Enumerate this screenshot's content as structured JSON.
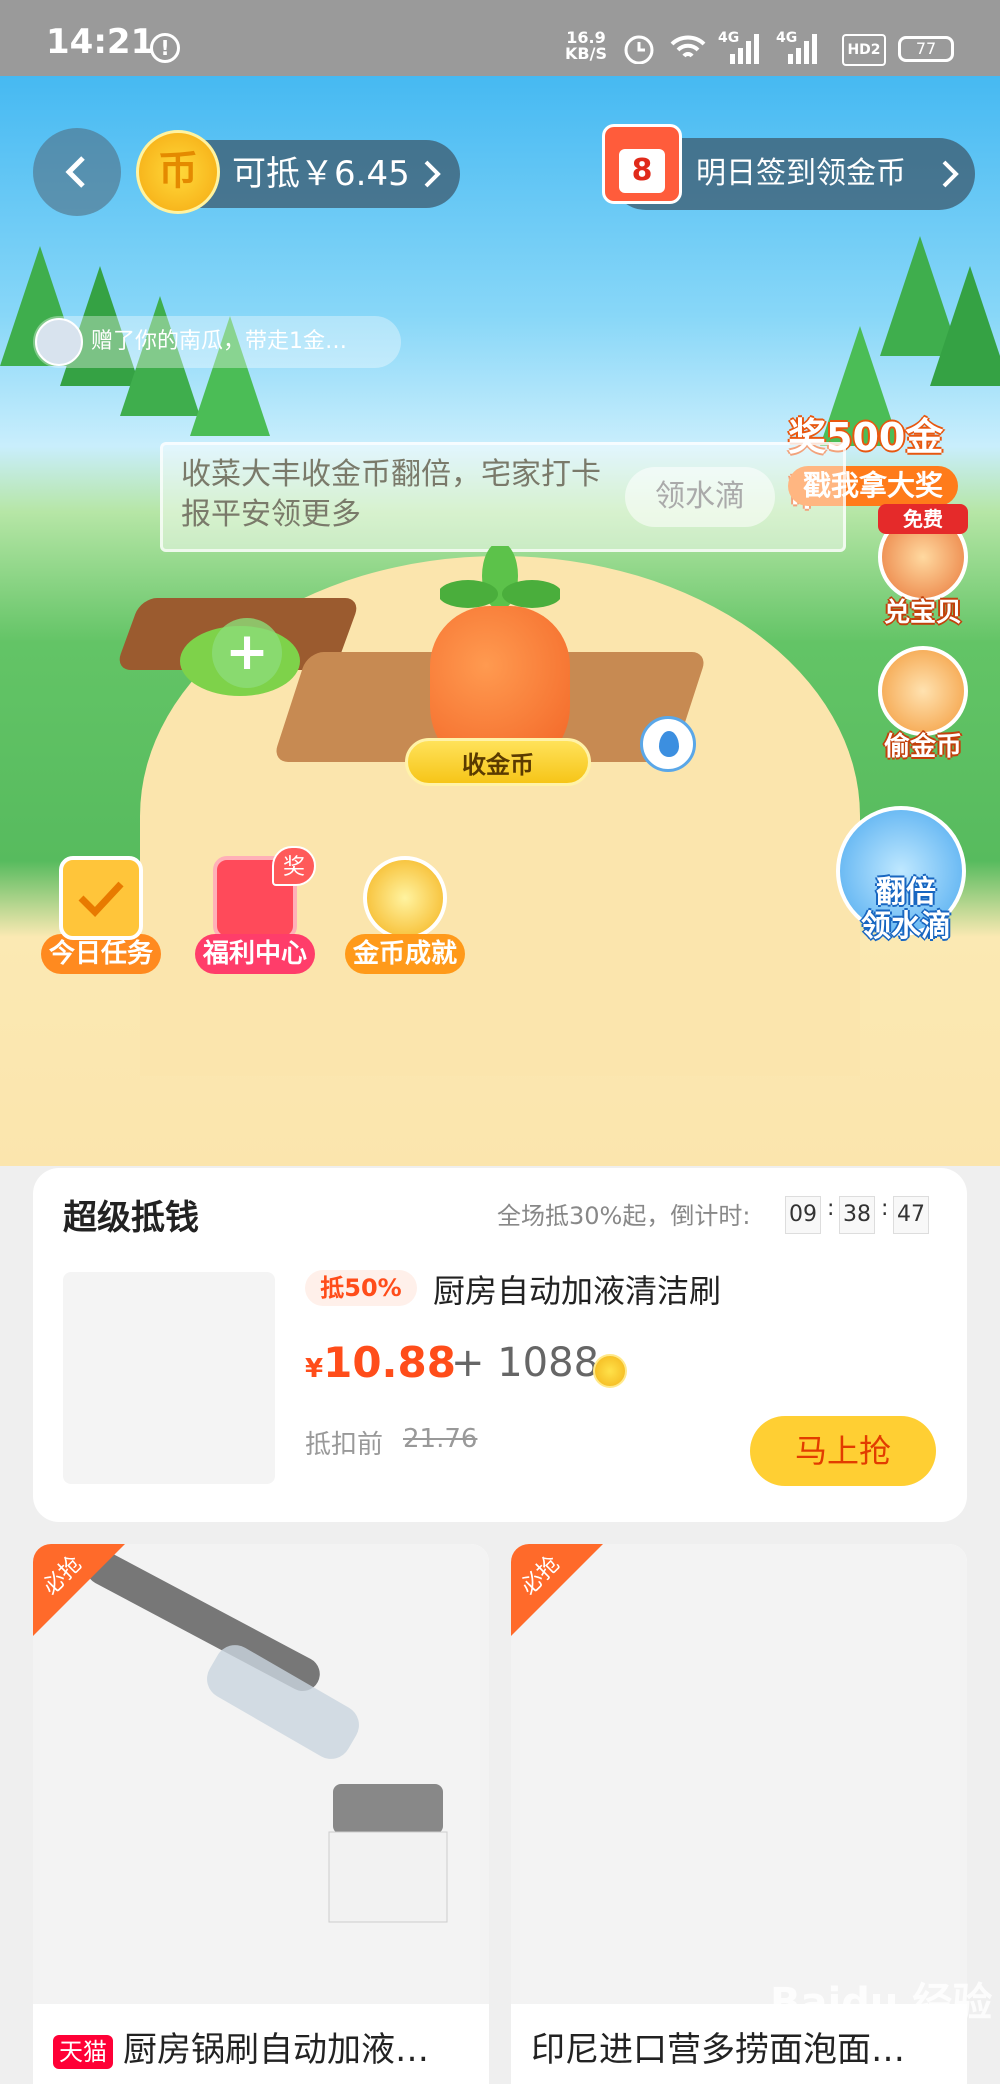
{
  "status_bar": {
    "time": "14:21",
    "net_speed_value": "16.9",
    "net_speed_unit": "KB/S",
    "signal_1": "4G",
    "signal_2": "4G",
    "hd": "HD2",
    "battery": "77"
  },
  "header": {
    "coin_symbol": "币",
    "coin_balance_text": "可抵￥6.45",
    "calendar_day": "8",
    "sign_in_text": "明日签到领金币"
  },
  "feed_message": "赠了你的南瓜，带走1金…",
  "promo": {
    "title": "奖500金币",
    "action": "戳我拿大奖"
  },
  "tip": {
    "text": "收菜大丰收金币翻倍，宅家打卡报平安领更多",
    "button": "领水滴"
  },
  "farm": {
    "collect_button": "收金币"
  },
  "side_actions": [
    {
      "label": "兑宝贝",
      "badge": "免费"
    },
    {
      "label": "偷金币"
    }
  ],
  "double_water": {
    "line1": "翻倍",
    "line2": "领水滴"
  },
  "bottom_icons": [
    {
      "label": "今日任务"
    },
    {
      "label": "福利中心",
      "badge": "奖"
    },
    {
      "label": "金币成就"
    }
  ],
  "super_deal": {
    "title": "超级抵钱",
    "countdown_label": "全场抵30%起，倒计时:",
    "countdown": [
      "09",
      "38",
      "47"
    ],
    "discount_tag": "抵50%",
    "product_name": "厨房自动加液清洁刷",
    "price_symbol": "¥",
    "price": "10.88",
    "plus_coins": "+ 1088",
    "original_label": "抵扣前",
    "original_price": "21.76",
    "buy_button": "马上抢"
  },
  "products": [
    {
      "corner": "必抢",
      "store_tag": "天猫",
      "name": "厨房锅刷自动加液…"
    },
    {
      "corner": "必抢",
      "name": "印尼进口营多捞面泡面…"
    }
  ],
  "watermark": "Baidu 经验",
  "colors": {
    "accent_orange": "#ff4d1a",
    "buy_yellow": "#ffcf33",
    "grass": "#57bb5e",
    "sky": "#46b9f2"
  }
}
